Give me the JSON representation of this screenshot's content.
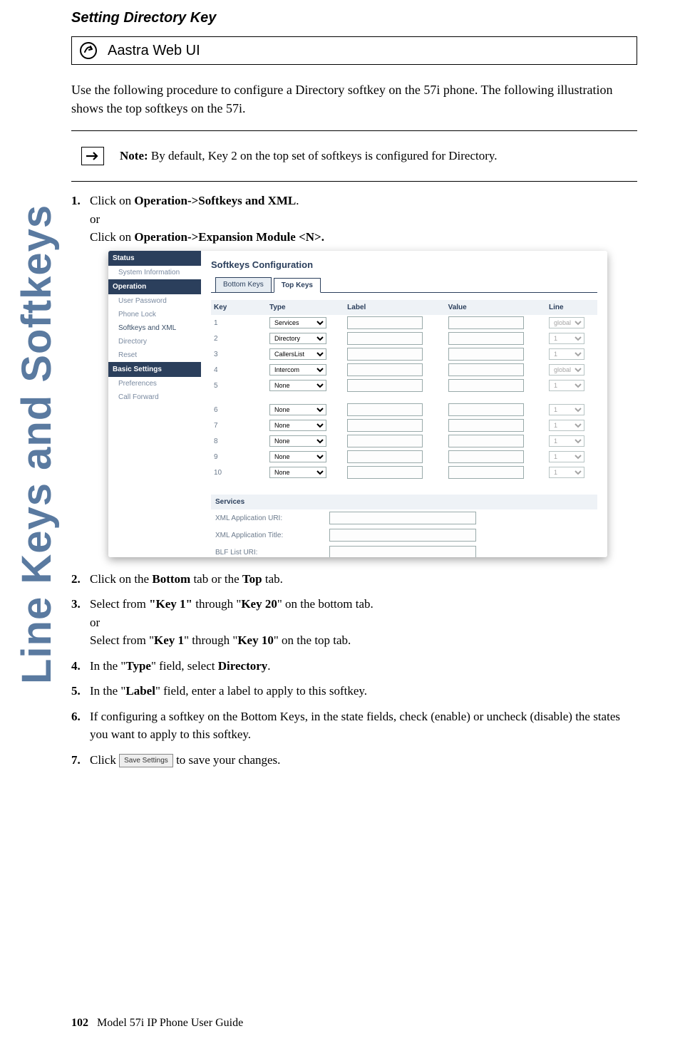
{
  "side_tab": "Line Keys and Softkeys",
  "section_title": "Setting Directory Key",
  "webui_label": "Aastra Web UI",
  "intro_text": "Use the following procedure to configure a Directory softkey on the 57i phone. The following illustration shows the top softkeys on the 57i.",
  "note": {
    "label": "Note:",
    "text": " By default, Key 2 on the top set of softkeys is configured for Directory."
  },
  "steps": {
    "s1_a_prefix": "Click on ",
    "s1_a_bold": "Operation->Softkeys and XML",
    "s1_a_suffix": ".",
    "s1_or": "or",
    "s1_b_prefix": "Click on ",
    "s1_b_bold": "Operation->Expansion Module <N>.",
    "s2": {
      "a": "Click on the ",
      "b": "Bottom",
      "c": " tab or the ",
      "d": "Top",
      "e": " tab."
    },
    "s3a": {
      "a": "Select from ",
      "b": "\"Key 1\"",
      "c": " through \"",
      "d": "Key 20",
      "e": "\" on the bottom tab."
    },
    "s3_or": "or",
    "s3b": {
      "a": "Select from \"",
      "b": "Key 1",
      "c": "\" through \"",
      "d": "Key 10",
      "e": "\" on the top tab."
    },
    "s4": {
      "a": "In the \"",
      "b": "Type",
      "c": "\" field, select ",
      "d": "Directory",
      "e": "."
    },
    "s5": {
      "a": "In the \"",
      "b": "Label",
      "c": "\" field, enter a label to apply to this softkey."
    },
    "s6": "If configuring a softkey on the Bottom Keys, in the state fields, check (enable) or uncheck (disable) the states you want to apply to this softkey.",
    "s7": {
      "a": "Click ",
      "btn": "Save Settings",
      "b": " to save your changes."
    }
  },
  "screenshot": {
    "nav": {
      "status": "Status",
      "status_items": [
        "System Information"
      ],
      "operation": "Operation",
      "operation_items": [
        "User Password",
        "Phone Lock",
        "Softkeys and XML",
        "Directory",
        "Reset"
      ],
      "basic": "Basic Settings",
      "basic_items": [
        "Preferences",
        "Call Forward"
      ]
    },
    "title": "Softkeys Configuration",
    "tabs": {
      "bottom": "Bottom Keys",
      "top": "Top Keys"
    },
    "headers": {
      "key": "Key",
      "type": "Type",
      "label": "Label",
      "value": "Value",
      "line": "Line"
    },
    "rows": [
      {
        "n": "1",
        "type": "Services",
        "line": "global"
      },
      {
        "n": "2",
        "type": "Directory",
        "line": "1"
      },
      {
        "n": "3",
        "type": "CallersList",
        "line": "1"
      },
      {
        "n": "4",
        "type": "Intercom",
        "line": "global"
      },
      {
        "n": "5",
        "type": "None",
        "line": "1"
      },
      {
        "n": "6",
        "type": "None",
        "line": "1"
      },
      {
        "n": "7",
        "type": "None",
        "line": "1"
      },
      {
        "n": "8",
        "type": "None",
        "line": "1"
      },
      {
        "n": "9",
        "type": "None",
        "line": "1"
      },
      {
        "n": "10",
        "type": "None",
        "line": "1"
      }
    ],
    "services": {
      "head": "Services",
      "xml_uri": "XML Application URI:",
      "xml_title": "XML Application Title:",
      "blf": "BLF List URI:"
    }
  },
  "footer": {
    "page": "102",
    "title": "Model 57i IP Phone User Guide"
  }
}
